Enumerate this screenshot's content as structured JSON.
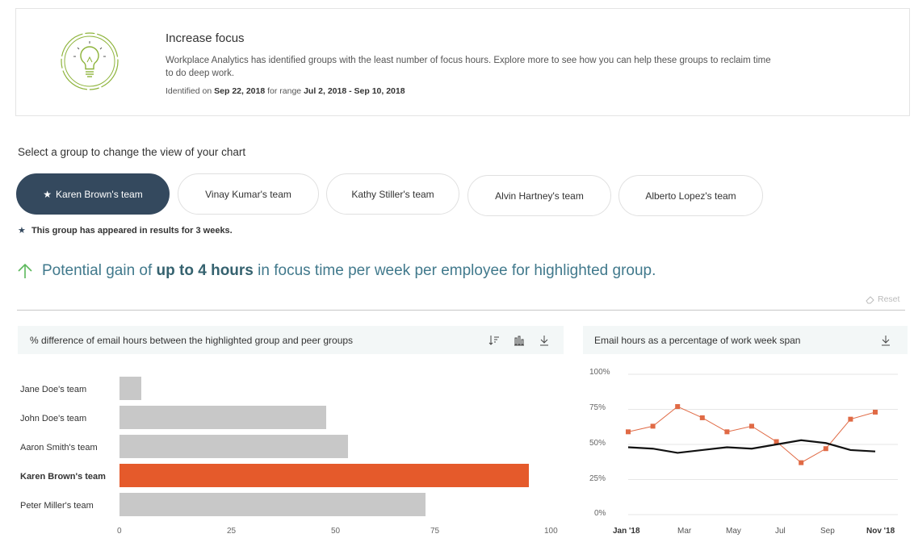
{
  "insight": {
    "title": "Increase focus",
    "description": "Workplace Analytics has identified groups with the least number of focus hours. Explore more to see how you can help these groups to reclaim time to do deep work.",
    "identified_prefix": "Identified on",
    "identified_date": "Sep 22, 2018",
    "range_prefix": "for range",
    "range": "Jul 2, 2018 - Sep 10, 2018",
    "icon": "lightbulb-icon",
    "accent_color": "#8db33a"
  },
  "group_select": {
    "label": "Select a group to change the view of your chart",
    "groups": [
      {
        "label": "Karen Brown's team",
        "selected": true
      },
      {
        "label": "Vinay Kumar's team",
        "selected": false
      },
      {
        "label": "Kathy Stiller's team",
        "selected": false
      },
      {
        "label": "Alvin Hartney's team",
        "selected": false
      },
      {
        "label": "Alberto Lopez's team",
        "selected": false
      }
    ],
    "appeared_note": "This group has appeared in results for 3 weeks.",
    "active_color": "#34495e"
  },
  "gain": {
    "prefix": "Potential gain of",
    "highlight": "up to 4 hours",
    "suffix": "in focus time per week per employee for highlighted group."
  },
  "reset_label": "Reset",
  "bar_chart": {
    "title": "% difference of email hours between the highlighted group and peer groups",
    "icons": [
      "sort-icon",
      "bar-chart-icon",
      "download-icon"
    ]
  },
  "line_chart": {
    "title": "Email hours as a percentage of work week span",
    "icons": [
      "download-icon"
    ]
  },
  "chart_data": [
    {
      "type": "bar",
      "orientation": "horizontal",
      "categories": [
        "Jane Doe's team",
        "John Doe's team",
        "Aaron Smith's team",
        "Karen Brown's team",
        "Peter Miller's team"
      ],
      "values": [
        5,
        48,
        53,
        95,
        71
      ],
      "highlighted": "Karen Brown's team",
      "highlight_color": "#e55a2b",
      "bar_color": "#c8c8c8",
      "xlim": [
        0,
        100
      ],
      "xticks": [
        "0",
        "25",
        "50",
        "75",
        "100"
      ]
    },
    {
      "type": "line",
      "x_tick_labels": [
        "Jan '18",
        "Mar",
        "May",
        "Jul",
        "Sep",
        "Nov '18"
      ],
      "y_tick_labels": [
        "100%",
        "75%",
        "50%",
        "25%",
        "0%"
      ],
      "ylim": [
        0,
        100
      ],
      "grid": true,
      "series": [
        {
          "color": "#e06a45",
          "marker": "square",
          "values": [
            59,
            63,
            77,
            69,
            59,
            63,
            52,
            37,
            47,
            68,
            73
          ]
        },
        {
          "color": "#111111",
          "marker": "none",
          "values": [
            48,
            47,
            44,
            46,
            48,
            47,
            50,
            53,
            51,
            46,
            45
          ]
        }
      ]
    }
  ]
}
